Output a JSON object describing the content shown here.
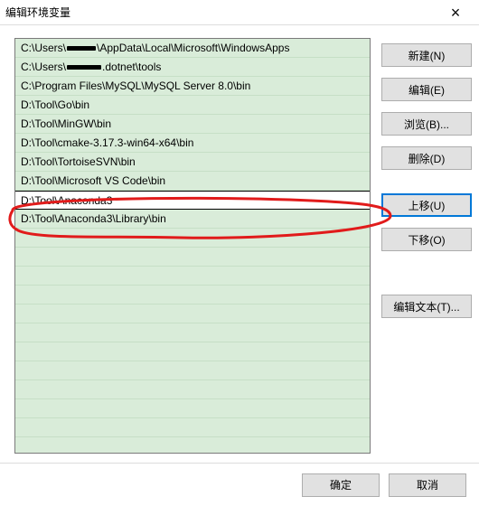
{
  "window": {
    "title": "编辑环境变量"
  },
  "paths": [
    {
      "prefix": "C:\\Users\\",
      "redact_width": 32,
      "suffix": "\\AppData\\Local\\Microsoft\\WindowsApps"
    },
    {
      "prefix": "C:\\Users\\",
      "redact_width": 38,
      "suffix": ".dotnet\\tools"
    },
    {
      "text": "C:\\Program Files\\MySQL\\MySQL Server 8.0\\bin"
    },
    {
      "text": "D:\\Tool\\Go\\bin"
    },
    {
      "text": "D:\\Tool\\MinGW\\bin"
    },
    {
      "text": "D:\\Tool\\cmake-3.17.3-win64-x64\\bin"
    },
    {
      "text": "D:\\Tool\\TortoiseSVN\\bin"
    },
    {
      "text": "D:\\Tool\\Microsoft VS Code\\bin"
    },
    {
      "text": "D:\\Tool\\Anaconda3",
      "selected": true
    },
    {
      "text": "D:\\Tool\\Anaconda3\\Library\\bin"
    }
  ],
  "fill_rows": 11,
  "buttons": {
    "new": "新建(N)",
    "edit": "编辑(E)",
    "browse": "浏览(B)...",
    "delete": "删除(D)",
    "moveUp": "上移(U)",
    "moveDown": "下移(O)",
    "editText": "编辑文本(T)...",
    "ok": "确定",
    "cancel": "取消"
  },
  "annotation": {
    "color": "#e11b1b"
  }
}
